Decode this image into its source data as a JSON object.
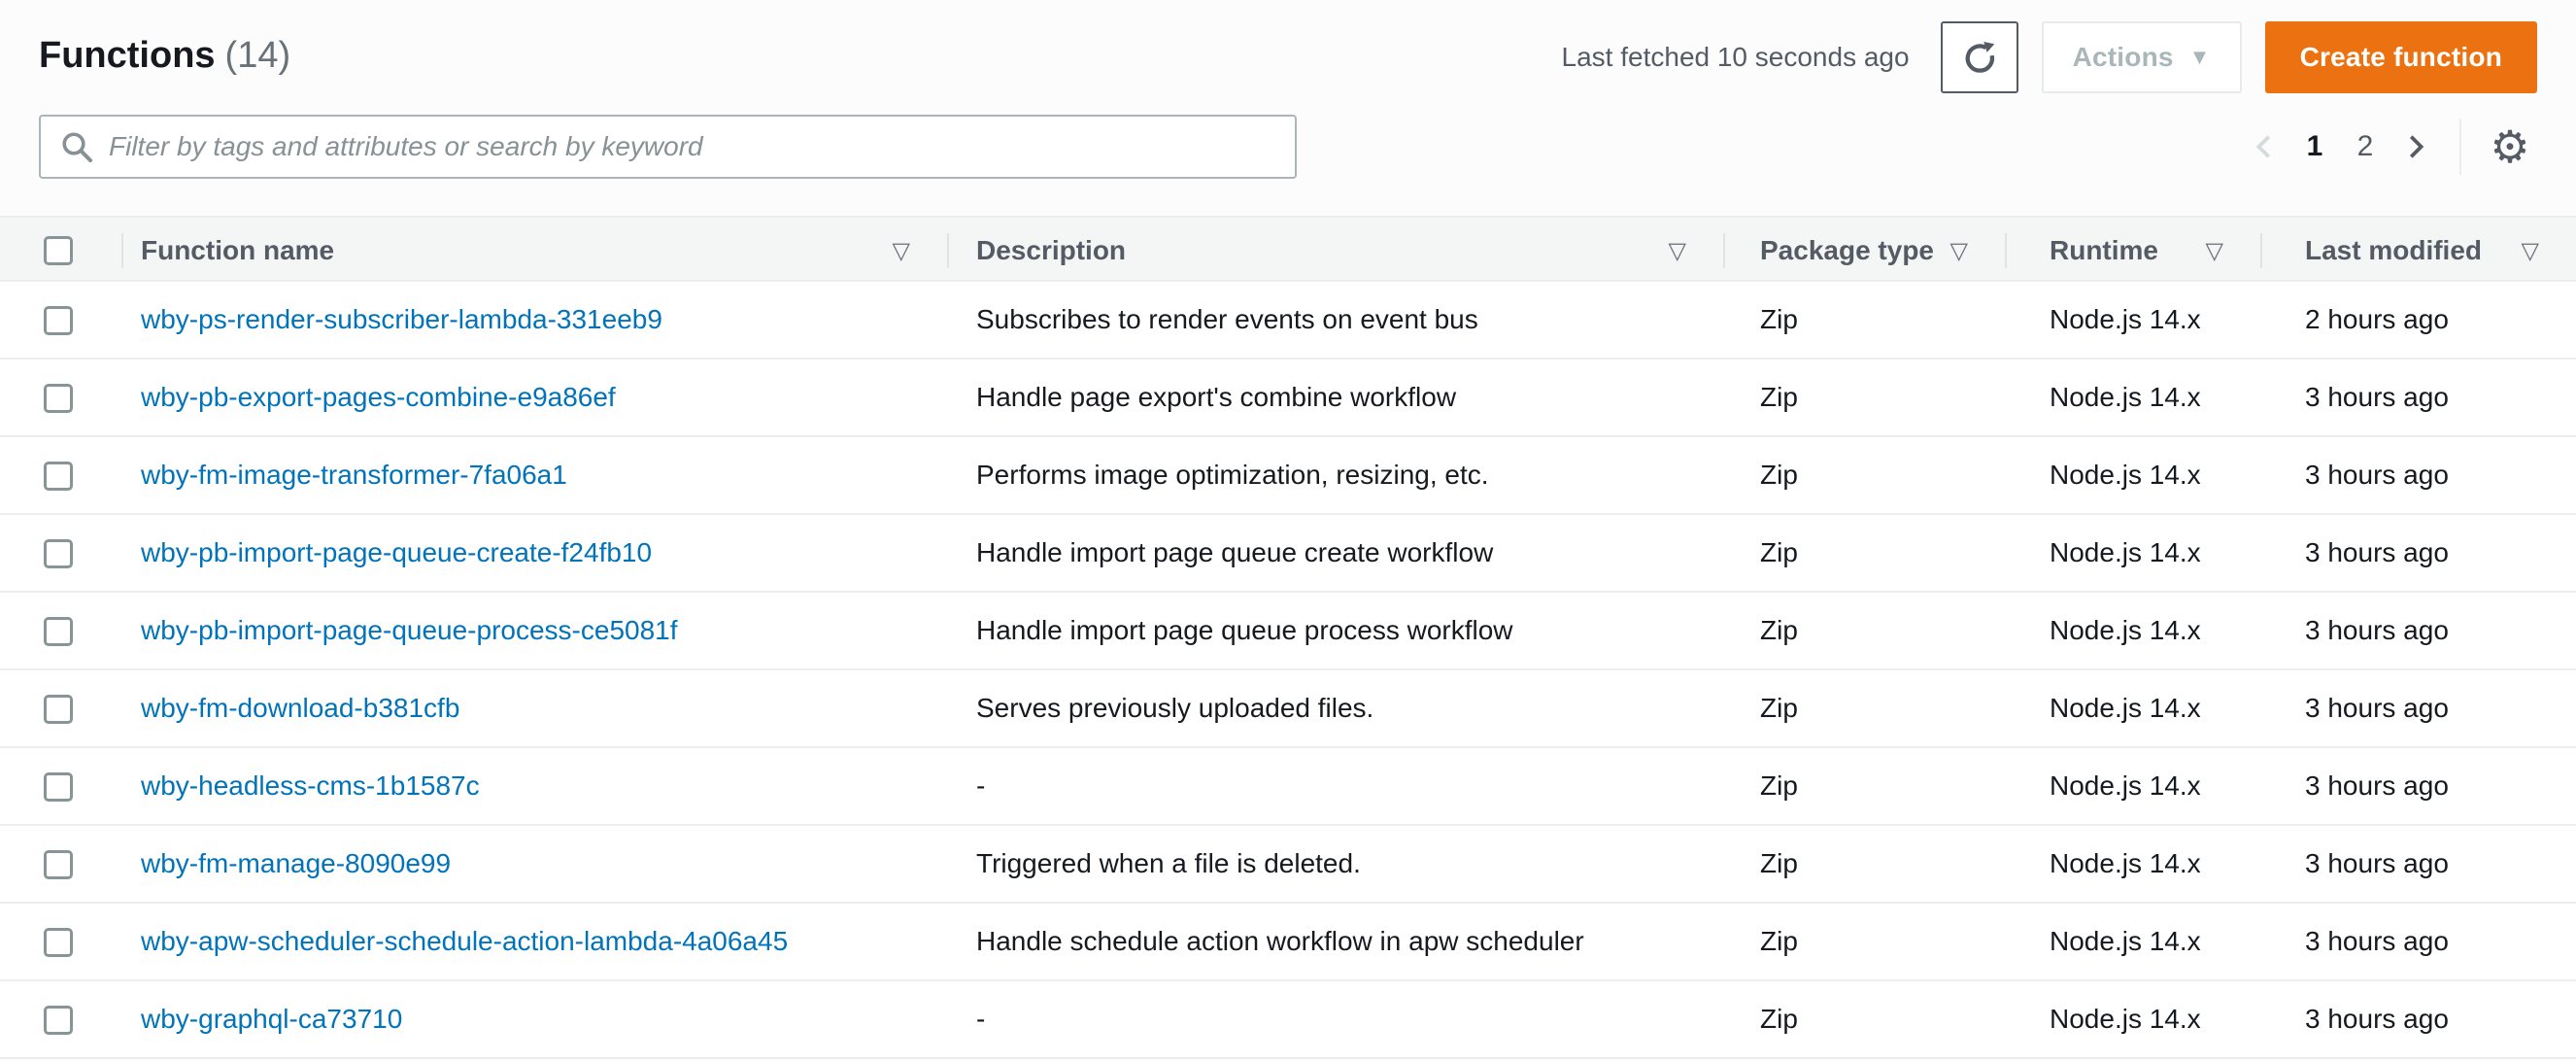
{
  "header": {
    "title": "Functions",
    "count": "(14)",
    "last_fetched": "Last fetched 10 seconds ago",
    "actions_label": "Actions",
    "create_label": "Create function"
  },
  "filter": {
    "placeholder": "Filter by tags and attributes or search by keyword"
  },
  "pagination": {
    "current_page": "1",
    "pages": [
      "1",
      "2"
    ]
  },
  "icons": {
    "refresh": "refresh-icon",
    "search": "search-icon",
    "sort": "▽",
    "caret": "▼",
    "gear": "⚙",
    "prev": "chevron-left-icon",
    "next": "chevron-right-icon"
  },
  "colors": {
    "link_blue": "#0073bb",
    "primary_orange": "#ec7211",
    "header_gray": "#545b64",
    "border_gray": "#eaeded"
  },
  "table": {
    "columns": [
      "Function name",
      "Description",
      "Package type",
      "Runtime",
      "Last modified"
    ],
    "rows": [
      {
        "name": "wby-ps-render-subscriber-lambda-331eeb9",
        "description": "Subscribes to render events on event bus",
        "package_type": "Zip",
        "runtime": "Node.js 14.x",
        "last_modified": "2 hours ago"
      },
      {
        "name": "wby-pb-export-pages-combine-e9a86ef",
        "description": "Handle page export's combine workflow",
        "package_type": "Zip",
        "runtime": "Node.js 14.x",
        "last_modified": "3 hours ago"
      },
      {
        "name": "wby-fm-image-transformer-7fa06a1",
        "description": "Performs image optimization, resizing, etc.",
        "package_type": "Zip",
        "runtime": "Node.js 14.x",
        "last_modified": "3 hours ago"
      },
      {
        "name": "wby-pb-import-page-queue-create-f24fb10",
        "description": "Handle import page queue create workflow",
        "package_type": "Zip",
        "runtime": "Node.js 14.x",
        "last_modified": "3 hours ago"
      },
      {
        "name": "wby-pb-import-page-queue-process-ce5081f",
        "description": "Handle import page queue process workflow",
        "package_type": "Zip",
        "runtime": "Node.js 14.x",
        "last_modified": "3 hours ago"
      },
      {
        "name": "wby-fm-download-b381cfb",
        "description": "Serves previously uploaded files.",
        "package_type": "Zip",
        "runtime": "Node.js 14.x",
        "last_modified": "3 hours ago"
      },
      {
        "name": "wby-headless-cms-1b1587c",
        "description": "-",
        "package_type": "Zip",
        "runtime": "Node.js 14.x",
        "last_modified": "3 hours ago"
      },
      {
        "name": "wby-fm-manage-8090e99",
        "description": "Triggered when a file is deleted.",
        "package_type": "Zip",
        "runtime": "Node.js 14.x",
        "last_modified": "3 hours ago"
      },
      {
        "name": "wby-apw-scheduler-schedule-action-lambda-4a06a45",
        "description": "Handle schedule action workflow in apw scheduler",
        "package_type": "Zip",
        "runtime": "Node.js 14.x",
        "last_modified": "3 hours ago"
      },
      {
        "name": "wby-graphql-ca73710",
        "description": "-",
        "package_type": "Zip",
        "runtime": "Node.js 14.x",
        "last_modified": "3 hours ago"
      }
    ]
  }
}
